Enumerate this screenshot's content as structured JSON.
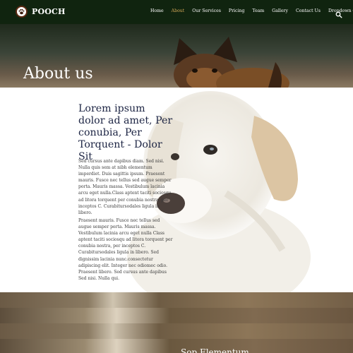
{
  "brand": {
    "name": "POOCH",
    "logo_icon": "paw-icon"
  },
  "nav": {
    "items": [
      {
        "label": "Home",
        "active": false
      },
      {
        "label": "About",
        "active": true
      },
      {
        "label": "Our Services",
        "active": false
      },
      {
        "label": "Pricing",
        "active": false
      },
      {
        "label": "Team",
        "active": false
      },
      {
        "label": "Gallery",
        "active": false
      },
      {
        "label": "Contact Us",
        "active": false
      },
      {
        "label": "Dropdown",
        "active": false,
        "has_caret": true
      }
    ],
    "search_icon": "search-icon"
  },
  "hero": {
    "title": "About us"
  },
  "content": {
    "heading": "Lorem ipsum dolor ad amet, Per conubia, Per Torquent - Dolor Sit",
    "paragraph1": "Sed cursus ante dapibus diam. Sed nisi. Nulla quis sem at nibh elementum imperdiet. Duis sagittis ipsum. Praesent mauris. Fusce nec tellus sed augue semper porta. Mauris massa. Vestibulum lacinia arcu eget nulla.Class aptent taciti sociosqu ad litora torquent per conubia nostra, per inceptos C. Curabitursodales ligula in libero.",
    "paragraph2": "Praesent mauris. Fusce nec tellus sed augue semper porta. Mauris massa. Vestibulum lacinia arcu eget nulla Class aptent taciti sociosqu ad litora torquent per conubia nostra, per inceptos C. Curabitursodales ligula in libero. Sed dignissim lacinia nunc.consectetur adipiscing elit. Integer nec odiomec odio. Praesent libero. Sed cursus ante dapibus Sed nisi. Nulla qui."
  },
  "bottom": {
    "title": "Sop Elementum"
  },
  "colors": {
    "navbar": "#10240f",
    "active_link": "#d4a857",
    "heading": "#1d2544"
  }
}
